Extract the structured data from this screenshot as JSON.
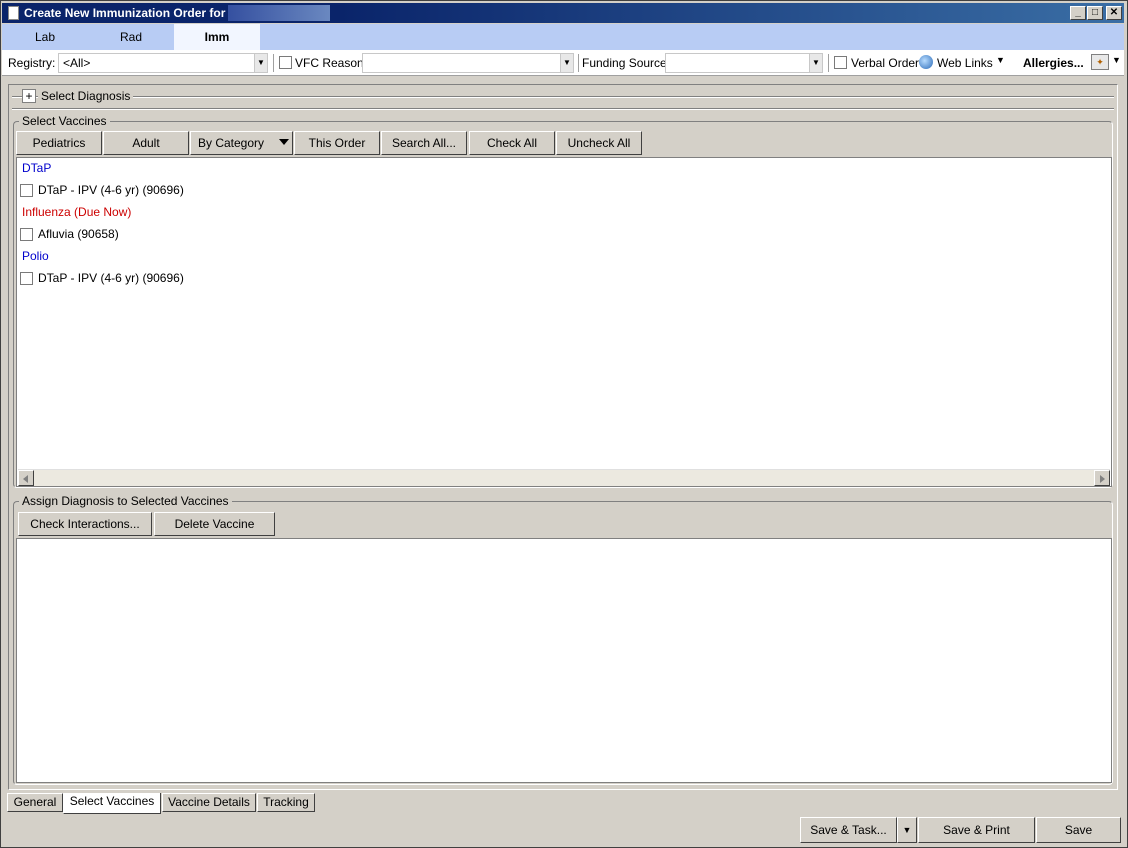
{
  "window": {
    "title": "Create New Immunization Order for",
    "controls": {
      "minimize": "_",
      "maximize": "□",
      "close": "✕"
    }
  },
  "order_tabs": [
    {
      "label": "Lab",
      "selected": false
    },
    {
      "label": "Rad",
      "selected": false
    },
    {
      "label": "Imm",
      "selected": true
    }
  ],
  "toolbar": {
    "registry_label": "Registry:",
    "registry_value": "<All>",
    "vfc_label": "VFC Reason",
    "vfc_checked": false,
    "vfc_value": "",
    "funding_label": "Funding Source:",
    "funding_value": "",
    "verbal_order_label": "Verbal Order",
    "verbal_order_checked": false,
    "web_links_label": "Web Links",
    "allergies_label": "Allergies..."
  },
  "diagnosis": {
    "expander": "+",
    "label": "Select Diagnosis"
  },
  "select_vaccines": {
    "label": "Select Vaccines",
    "buttons": {
      "pediatrics": "Pediatrics",
      "adult": "Adult",
      "by_category": "By Category",
      "this_order": "This Order",
      "search_all": "Search All...",
      "check_all": "Check All",
      "uncheck_all": "Uncheck All"
    },
    "groups": [
      {
        "category": "DTaP",
        "color": "#0000cc",
        "items": [
          {
            "label": "DTaP - IPV (4-6 yr) (90696)",
            "checked": false
          }
        ]
      },
      {
        "category": "Influenza (Due Now)",
        "color": "#cc0000",
        "items": [
          {
            "label": "Afluvia (90658)",
            "checked": false
          }
        ]
      },
      {
        "category": "Polio",
        "color": "#0000cc",
        "items": [
          {
            "label": "DTaP - IPV (4-6 yr) (90696)",
            "checked": false
          }
        ]
      }
    ]
  },
  "assign": {
    "label": "Assign Diagnosis to Selected Vaccines",
    "buttons": {
      "check_interactions": "Check Interactions...",
      "delete_vaccine": "Delete Vaccine"
    }
  },
  "bottom_tabs": [
    {
      "label": "General",
      "selected": false
    },
    {
      "label": "Select Vaccines",
      "selected": true
    },
    {
      "label": "Vaccine Details",
      "selected": false
    },
    {
      "label": "Tracking",
      "selected": false
    }
  ],
  "actions": {
    "save_task": "Save & Task...",
    "save_print": "Save & Print",
    "save": "Save"
  },
  "colors": {
    "title_bar": "#0a246a",
    "tab_strip": "#b8ccf4",
    "category_blue": "#0000cc",
    "category_red": "#cc0000",
    "face": "#d4d0c8"
  }
}
